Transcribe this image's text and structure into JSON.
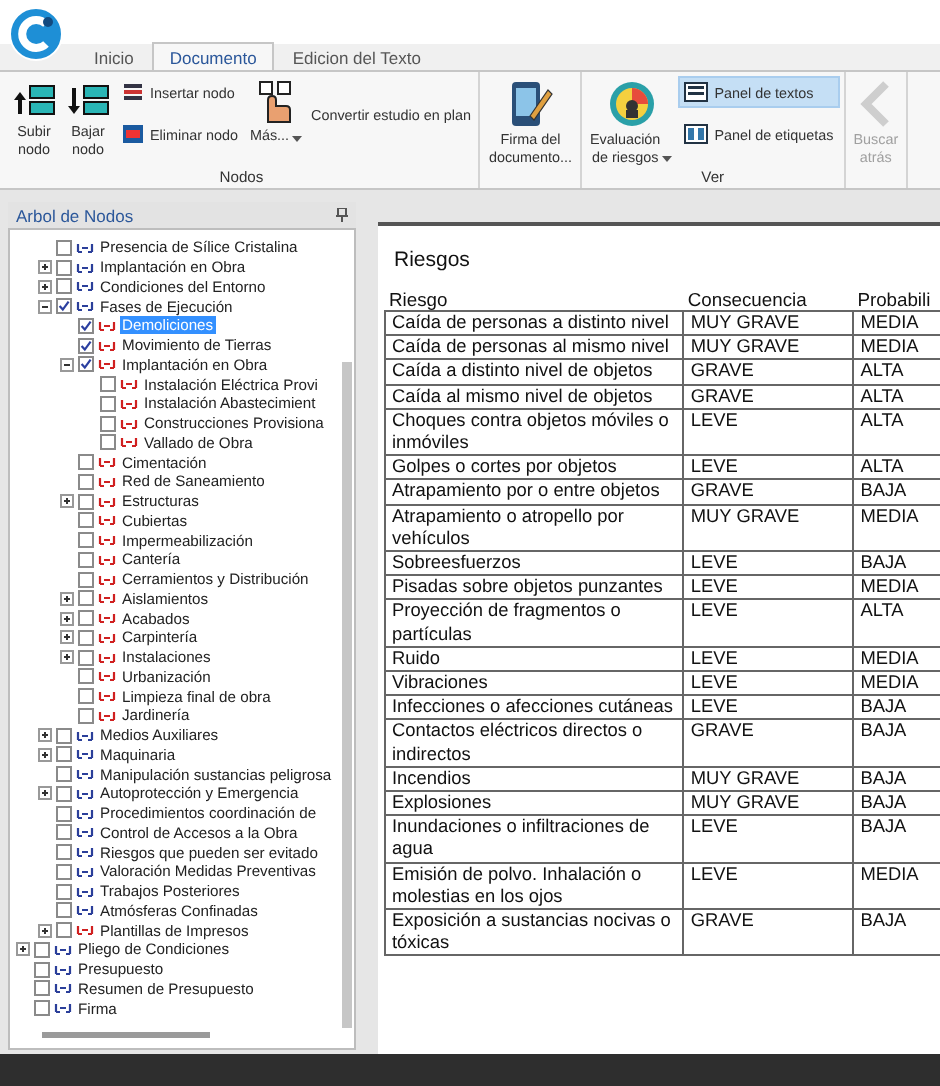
{
  "tabs": [
    {
      "label": "Inicio",
      "selected": false
    },
    {
      "label": "Documento",
      "selected": true
    },
    {
      "label": "Edicion del Texto",
      "selected": false
    }
  ],
  "ribbon": {
    "groups": [
      {
        "label": "Nodos",
        "buttons": [
          {
            "kind": "large",
            "label": "Subir nodo",
            "dropdown": false,
            "disabled": false
          },
          {
            "kind": "large",
            "label": "Bajar nodo",
            "dropdown": false,
            "disabled": false
          },
          {
            "kind": "small",
            "label": "Insertar nodo",
            "dropdown": false,
            "disabled": false
          },
          {
            "kind": "small",
            "label": "Eliminar nodo",
            "dropdown": false,
            "disabled": false
          },
          {
            "kind": "large",
            "label": "Más...",
            "dropdown": true,
            "disabled": false
          },
          {
            "kind": "text",
            "label": "Convertir estudio en plan",
            "dropdown": false,
            "disabled": false
          }
        ]
      },
      {
        "buttons": [
          {
            "kind": "large",
            "label": "Firma del documento...",
            "dropdown": false,
            "disabled": false
          }
        ]
      },
      {
        "label": "Ver",
        "buttons": [
          {
            "kind": "large",
            "label": "Evaluación de riesgos",
            "dropdown": true,
            "disabled": false
          },
          {
            "kind": "toggle",
            "label": "Panel de textos",
            "selected": true,
            "dropdown": false,
            "disabled": false
          },
          {
            "kind": "toggle",
            "label": "Panel de etiquetas",
            "selected": false,
            "dropdown": false,
            "disabled": false
          }
        ]
      },
      {
        "buttons": [
          {
            "kind": "large",
            "label": "Buscar atrás",
            "dropdown": false,
            "disabled": true
          }
        ]
      }
    ]
  },
  "tree_panel": {
    "title": "Arbol de Nodos",
    "nodes": [
      {
        "children": [
          {
            "label": "Presencia de Sílice Cristalina",
            "kind": "chapter",
            "checked": false,
            "selected": false
          },
          {
            "label": "Implantación en Obra",
            "kind": "chapter",
            "checked": false,
            "selected": false,
            "expanded": false
          },
          {
            "label": "Condiciones del Entorno",
            "kind": "chapter",
            "checked": false,
            "selected": false,
            "expanded": false
          },
          {
            "label": "Fases de Ejecución",
            "kind": "chapter",
            "checked": true,
            "selected": false,
            "expanded": true,
            "children": [
              {
                "label": "Demoliciones",
                "kind": "unit",
                "checked": true,
                "selected": true
              },
              {
                "label": "Movimiento de Tierras",
                "kind": "unit",
                "checked": true,
                "selected": false
              },
              {
                "label": "Implantación en Obra",
                "kind": "unit",
                "checked": true,
                "selected": false,
                "expanded": true,
                "children": [
                  {
                    "label": "Instalación Eléctrica Provi",
                    "kind": "unit",
                    "checked": false,
                    "selected": false
                  },
                  {
                    "label": "Instalación Abastecimient",
                    "kind": "unit",
                    "checked": false,
                    "selected": false
                  },
                  {
                    "label": "Construcciones Provisiona",
                    "kind": "unit",
                    "checked": false,
                    "selected": false
                  },
                  {
                    "label": "Vallado de Obra",
                    "kind": "unit",
                    "checked": false,
                    "selected": false
                  }
                ]
              },
              {
                "label": "Cimentación",
                "kind": "unit",
                "checked": false,
                "selected": false
              },
              {
                "label": "Red de Saneamiento",
                "kind": "unit",
                "checked": false,
                "selected": false
              },
              {
                "label": "Estructuras",
                "kind": "unit",
                "checked": false,
                "selected": false,
                "expanded": false
              },
              {
                "label": "Cubiertas",
                "kind": "unit",
                "checked": false,
                "selected": false
              },
              {
                "label": "Impermeabilización",
                "kind": "unit",
                "checked": false,
                "selected": false
              },
              {
                "label": "Cantería",
                "kind": "unit",
                "checked": false,
                "selected": false
              },
              {
                "label": "Cerramientos y Distribución",
                "kind": "unit",
                "checked": false,
                "selected": false
              },
              {
                "label": "Aislamientos",
                "kind": "unit",
                "checked": false,
                "selected": false,
                "expanded": false
              },
              {
                "label": "Acabados",
                "kind": "unit",
                "checked": false,
                "selected": false,
                "expanded": false
              },
              {
                "label": "Carpintería",
                "kind": "unit",
                "checked": false,
                "selected": false,
                "expanded": false
              },
              {
                "label": "Instalaciones",
                "kind": "unit",
                "checked": false,
                "selected": false,
                "expanded": false
              },
              {
                "label": "Urbanización",
                "kind": "unit",
                "checked": false,
                "selected": false
              },
              {
                "label": "Limpieza final de obra",
                "kind": "unit",
                "checked": false,
                "selected": false
              },
              {
                "label": "Jardinería",
                "kind": "unit",
                "checked": false,
                "selected": false
              }
            ]
          },
          {
            "label": "Medios Auxiliares",
            "kind": "chapter",
            "checked": false,
            "selected": false,
            "expanded": false
          },
          {
            "label": "Maquinaria",
            "kind": "chapter",
            "checked": false,
            "selected": false,
            "expanded": false
          },
          {
            "label": "Manipulación sustancias peligrosa",
            "kind": "chapter",
            "checked": false,
            "selected": false
          },
          {
            "label": "Autoprotección y Emergencia",
            "kind": "chapter",
            "checked": false,
            "selected": false,
            "expanded": false
          },
          {
            "label": "Procedimientos coordinación de",
            "kind": "chapter",
            "checked": false,
            "selected": false
          },
          {
            "label": "Control de Accesos a la Obra",
            "kind": "chapter",
            "checked": false,
            "selected": false
          },
          {
            "label": "Riesgos que pueden ser evitado",
            "kind": "chapter",
            "checked": false,
            "selected": false
          },
          {
            "label": "Valoración Medidas Preventivas",
            "kind": "chapter",
            "checked": false,
            "selected": false
          },
          {
            "label": "Trabajos Posteriores",
            "kind": "chapter",
            "checked": false,
            "selected": false
          },
          {
            "label": "Atmósferas Confinadas",
            "kind": "chapter",
            "checked": false,
            "selected": false
          },
          {
            "label": "Plantillas de Impresos",
            "kind": "unit",
            "checked": false,
            "selected": false,
            "expanded": false
          }
        ]
      },
      {
        "label": "Pliego de Condiciones",
        "kind": "chapter",
        "checked": false,
        "selected": false,
        "expanded": false
      },
      {
        "label": "Presupuesto",
        "kind": "chapter",
        "checked": false,
        "selected": false
      },
      {
        "label": "Resumen de Presupuesto",
        "kind": "chapter",
        "checked": false,
        "selected": false
      },
      {
        "label": "Firma",
        "kind": "chapter",
        "checked": false,
        "selected": false
      }
    ]
  },
  "document": {
    "heading": "Riesgos",
    "table": {
      "columns": [
        "Riesgo",
        "Consecuencia",
        "Probabili"
      ],
      "rows": [
        [
          "Caída de personas a distinto nivel",
          "MUY GRAVE",
          "MEDIA"
        ],
        [
          "Caída de personas al mismo nivel",
          "MUY GRAVE",
          "MEDIA"
        ],
        [
          "Caída a distinto nivel de objetos",
          "GRAVE",
          "ALTA"
        ],
        [
          "Caída al mismo nivel de objetos",
          "GRAVE",
          "ALTA"
        ],
        [
          "Choques contra objetos móviles o inmóviles",
          "LEVE",
          "ALTA"
        ],
        [
          "Golpes o cortes por objetos",
          "LEVE",
          "ALTA"
        ],
        [
          "Atrapamiento por o entre objetos",
          "GRAVE",
          "BAJA"
        ],
        [
          "Atrapamiento o atropello por vehículos",
          "MUY GRAVE",
          "MEDIA"
        ],
        [
          "Sobreesfuerzos",
          "LEVE",
          "BAJA"
        ],
        [
          "Pisadas sobre objetos punzantes",
          "LEVE",
          "MEDIA"
        ],
        [
          "Proyección de fragmentos o partículas",
          "LEVE",
          "ALTA"
        ],
        [
          "Ruido",
          "LEVE",
          "MEDIA"
        ],
        [
          "Vibraciones",
          "LEVE",
          "MEDIA"
        ],
        [
          "Infecciones o afecciones cutáneas",
          "LEVE",
          "BAJA"
        ],
        [
          "Contactos eléctricos directos o indirectos",
          "GRAVE",
          "BAJA"
        ],
        [
          "Incendios",
          "MUY GRAVE",
          "BAJA"
        ],
        [
          "Explosiones",
          "MUY GRAVE",
          "BAJA"
        ],
        [
          "Inundaciones o infiltraciones de agua",
          "LEVE",
          "BAJA"
        ],
        [
          "Emisión de polvo. Inhalación o molestias en los ojos",
          "LEVE",
          "MEDIA"
        ],
        [
          "Exposición a sustancias nocivas o tóxicas",
          "GRAVE",
          "BAJA"
        ]
      ]
    }
  }
}
